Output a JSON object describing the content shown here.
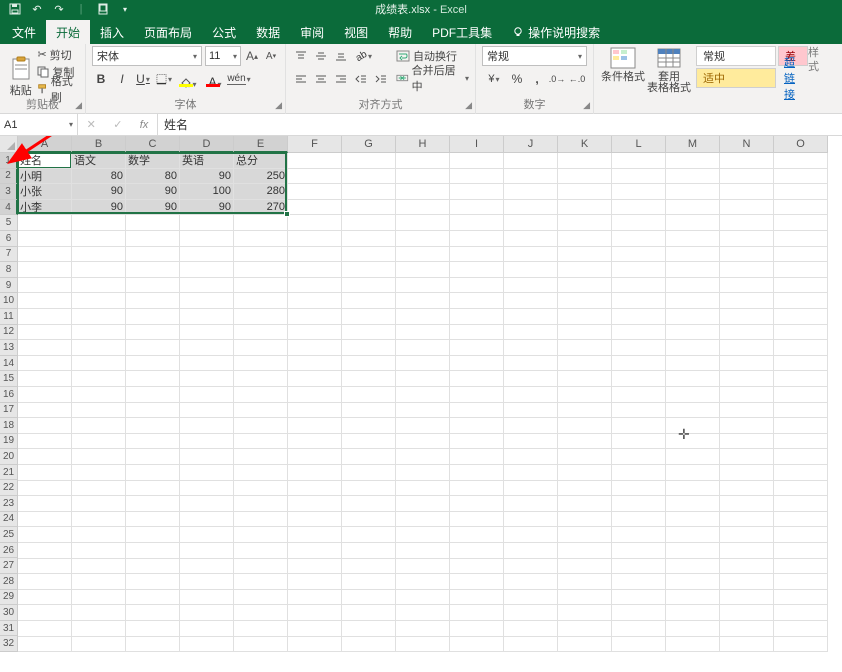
{
  "qat": {
    "doc_title": "成绩表.xlsx",
    "app_name": "Excel"
  },
  "tabs": {
    "file": "文件",
    "home": "开始",
    "insert": "插入",
    "layout": "页面布局",
    "formulas": "公式",
    "data": "数据",
    "review": "审阅",
    "view": "视图",
    "help": "帮助",
    "pdf": "PDF工具集",
    "tell": "操作说明搜索"
  },
  "ribbon": {
    "clipboard": {
      "paste": "粘贴",
      "cut": "剪切",
      "copy": "复制",
      "painter": "格式刷",
      "label": "剪贴板"
    },
    "font": {
      "name": "宋体",
      "size": "11",
      "label": "字体"
    },
    "align": {
      "wrap": "自动换行",
      "merge": "合并后居中",
      "label": "对齐方式"
    },
    "number": {
      "format": "常规",
      "label": "数字"
    },
    "styles": {
      "cond": "条件格式",
      "table": "套用\n表格格式",
      "normal": "常规",
      "neutral": "适中",
      "bad": "差",
      "link": "超链接",
      "label": "样式"
    }
  },
  "fx": {
    "name_box": "A1",
    "value": "姓名"
  },
  "columns": [
    "A",
    "B",
    "C",
    "D",
    "E",
    "F",
    "G",
    "H",
    "I",
    "J",
    "K",
    "L",
    "M",
    "N",
    "O"
  ],
  "rows_count": 33,
  "selected_rows": [
    1,
    2,
    3,
    4
  ],
  "selected_cols": [
    "A",
    "B",
    "C",
    "D",
    "E"
  ],
  "chart_data": {
    "type": "table",
    "headers": [
      "姓名",
      "语文",
      "数学",
      "英语",
      "总分"
    ],
    "rows": [
      {
        "name": "小明",
        "chinese": 80,
        "math": 80,
        "english": 90,
        "total": 250
      },
      {
        "name": "小张",
        "chinese": 90,
        "math": 90,
        "english": 100,
        "total": 280
      },
      {
        "name": "小李",
        "chinese": 90,
        "math": 90,
        "english": 90,
        "total": 270
      }
    ]
  }
}
